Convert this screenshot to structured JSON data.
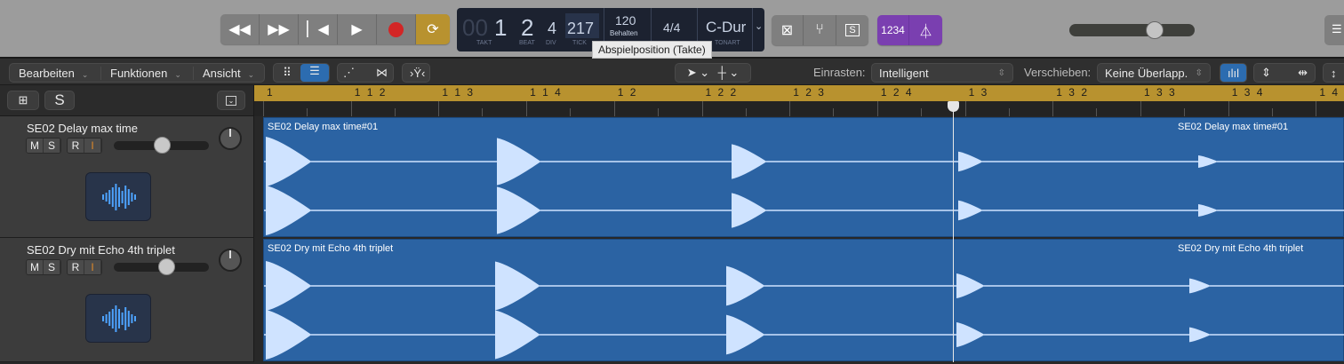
{
  "transport": {
    "buttons": [
      "rewind",
      "fast-forward",
      "go-to-start",
      "play",
      "record",
      "cycle"
    ],
    "lcd": {
      "takt": "1",
      "takt_prefix": "00",
      "beat": "2",
      "div": "4",
      "tick": "217",
      "labels": {
        "takt": "TAKT",
        "beat": "BEAT",
        "div": "DIV",
        "tick": "TICK",
        "tonart": "TONART"
      },
      "tempo": "120",
      "tempo_mode": "Behalten",
      "signature": "4/4",
      "key": "C-Dur"
    },
    "tooltip": "Abspielposition (Takte)",
    "count_in": "1234",
    "colors": {
      "cycle": "#b8922f",
      "record": "#d32626",
      "purple": "#7a3fb0",
      "ruler": "#b8922f",
      "region": "#2b63a3"
    },
    "master_volume": 0.68
  },
  "menubar": {
    "items": [
      "Bearbeiten",
      "Funktionen",
      "Ansicht"
    ],
    "snap_label": "Einrasten:",
    "snap_value": "Intelligent",
    "drag_label": "Verschieben:",
    "drag_value": "Keine Überlapp."
  },
  "header": {
    "solo": "S"
  },
  "ruler": {
    "markers": [
      "1",
      "1 1 2",
      "1 1 3",
      "1 1 4",
      "1 2",
      "1 2 2",
      "1 2 3",
      "1 2 4",
      "1 3",
      "1 3 2",
      "1 3 3",
      "1 3 4",
      "1 4"
    ]
  },
  "tracks": [
    {
      "name": "SE02 Delay max time",
      "region": "SE02 Delay max time#01",
      "m": "M",
      "s": "S",
      "r": "R",
      "i": "I",
      "volume": 0.54
    },
    {
      "name": "SE02 Dry mit Echo 4th triplet",
      "region": "SE02 Dry mit Echo 4th triplet",
      "m": "M",
      "s": "S",
      "r": "R",
      "i": "I",
      "volume": 0.59
    }
  ]
}
